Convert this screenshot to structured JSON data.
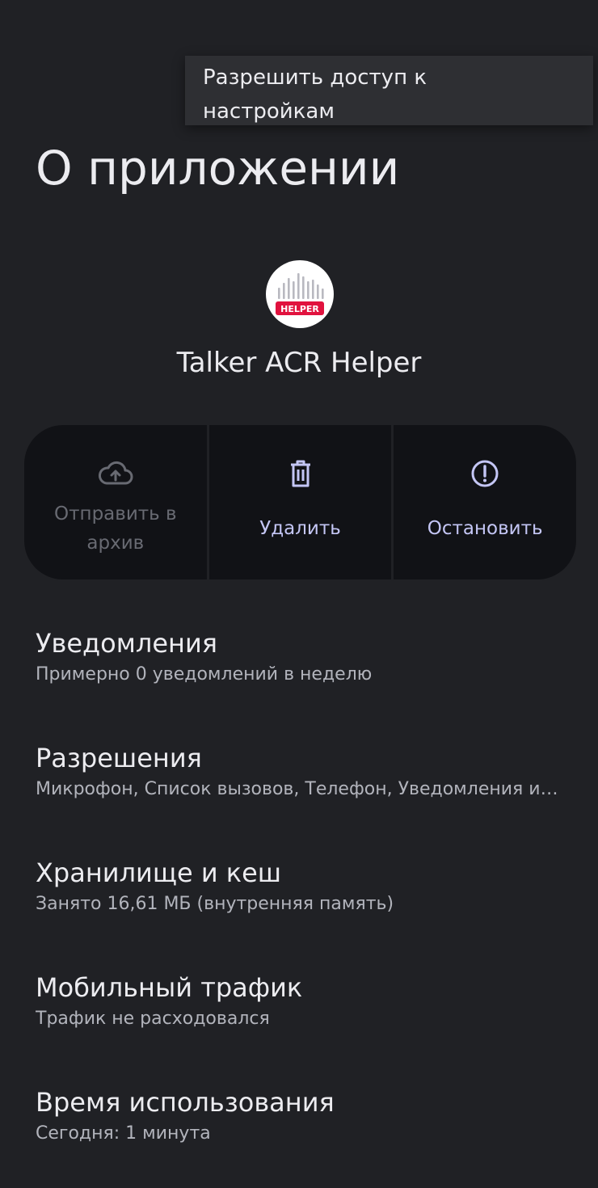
{
  "menu": {
    "items": [
      {
        "label_line1": "Разрешить доступ к",
        "label_line2": "настройкам"
      }
    ]
  },
  "page": {
    "title": "О приложении"
  },
  "app": {
    "name": "Talker ACR Helper",
    "icon_badge": "HELPER",
    "icon": "sound-wave-icon",
    "accent_color": "#e1123e"
  },
  "actions": [
    {
      "label": "Отправить в архив",
      "icon": "cloud-upload-icon",
      "enabled": false
    },
    {
      "label": "Удалить",
      "icon": "trash-icon",
      "enabled": true
    },
    {
      "label": "Остановить",
      "icon": "force-stop-icon",
      "enabled": true
    }
  ],
  "settings": [
    {
      "title": "Уведомления",
      "summary": "Примерно 0 уведомлений в неделю"
    },
    {
      "title": "Разрешения",
      "summary": "Микрофон, Список вызовов, Телефон, Уведомления и ..."
    },
    {
      "title": "Хранилище и кеш",
      "summary": "Занято 16,61 МБ (внутренняя память)"
    },
    {
      "title": "Мобильный трафик",
      "summary": "Трафик не расходовался"
    },
    {
      "title": "Время использования",
      "summary": "Сегодня: 1 минута"
    }
  ],
  "colors": {
    "background": "#202125",
    "action_accent": "#c4c6f5",
    "action_disabled": "#686a72"
  }
}
